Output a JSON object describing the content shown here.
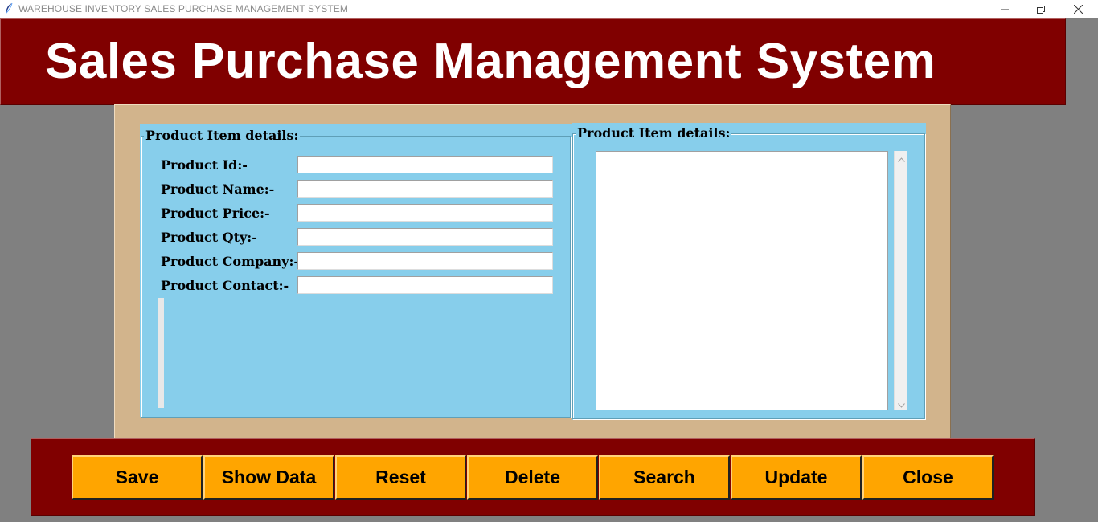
{
  "window": {
    "title": "WAREHOUSE INVENTORY SALES PURCHASE MANAGEMENT SYSTEM",
    "minimize_icon": "minimize-icon",
    "restore_icon": "restore-icon",
    "close_icon": "close-icon"
  },
  "header": {
    "title": "Sales Purchase Management System",
    "background": "#800000"
  },
  "left_panel": {
    "legend": "Product Item details:",
    "fields": [
      {
        "label": "Product Id:-",
        "value": ""
      },
      {
        "label": "Product Name:-",
        "value": ""
      },
      {
        "label": "Product Price:-",
        "value": ""
      },
      {
        "label": "Product Qty:-",
        "value": ""
      },
      {
        "label": "Product Company:-",
        "value": ""
      },
      {
        "label": "Product Contact:-",
        "value": ""
      }
    ]
  },
  "right_panel": {
    "legend": "Product Item details:",
    "text": ""
  },
  "buttons": {
    "save": "Save",
    "show_data": "Show Data",
    "reset": "Reset",
    "delete": "Delete",
    "search": "Search",
    "update": "Update",
    "close": "Close"
  },
  "colors": {
    "maroon": "#800000",
    "tan": "#d2b48c",
    "sky_blue": "#87ceeb",
    "orange": "#ffa500",
    "grey_background": "#808080"
  }
}
